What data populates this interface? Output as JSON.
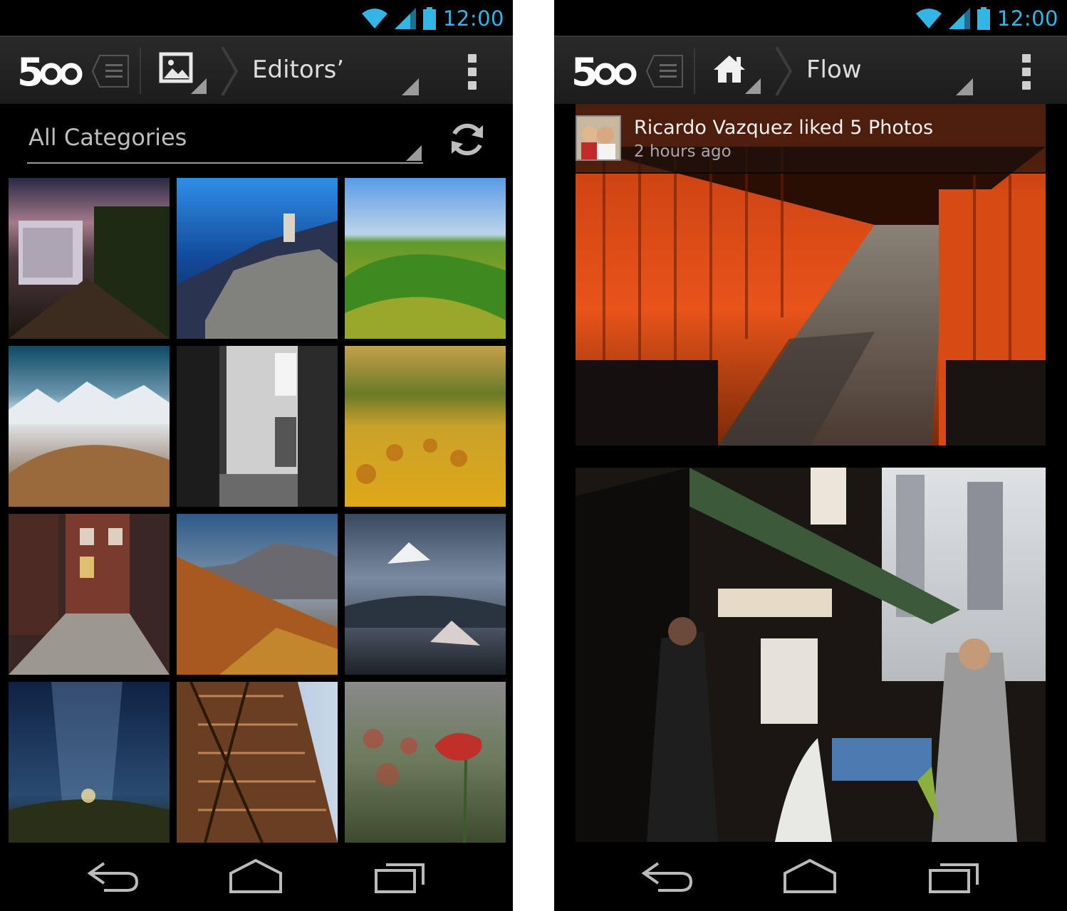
{
  "status_bar": {
    "time": "12:00",
    "accent_color": "#33b5e5"
  },
  "left_screen": {
    "app_logo": "500px",
    "section_icon": "image-icon",
    "section_title": "Editors’",
    "category_filter": "All Categories",
    "photos": [
      {
        "subject": "paris-street-dusk"
      },
      {
        "subject": "santorini-windmill"
      },
      {
        "subject": "green-rolling-hills"
      },
      {
        "subject": "snowy-mountain-range"
      },
      {
        "subject": "bw-alley-courtyard"
      },
      {
        "subject": "hay-bale-field"
      },
      {
        "subject": "brick-city-street"
      },
      {
        "subject": "autumn-mountain-ridge"
      },
      {
        "subject": "volcano-above-clouds"
      },
      {
        "subject": "milky-way-night-path"
      },
      {
        "subject": "eiffel-tower-detail"
      },
      {
        "subject": "red-poppy-field"
      }
    ]
  },
  "right_screen": {
    "app_logo": "500px",
    "section_icon": "home-icon",
    "section_title": "Flow",
    "activity": {
      "text": "Ricardo Vazquez liked 5 Photos",
      "time": "2 hours ago"
    },
    "feed_photos": [
      {
        "subject": "torii-gate-corridor"
      },
      {
        "subject": "japanese-fish-market"
      }
    ]
  },
  "nav_bar": {
    "buttons": [
      "back",
      "home",
      "recents"
    ]
  }
}
